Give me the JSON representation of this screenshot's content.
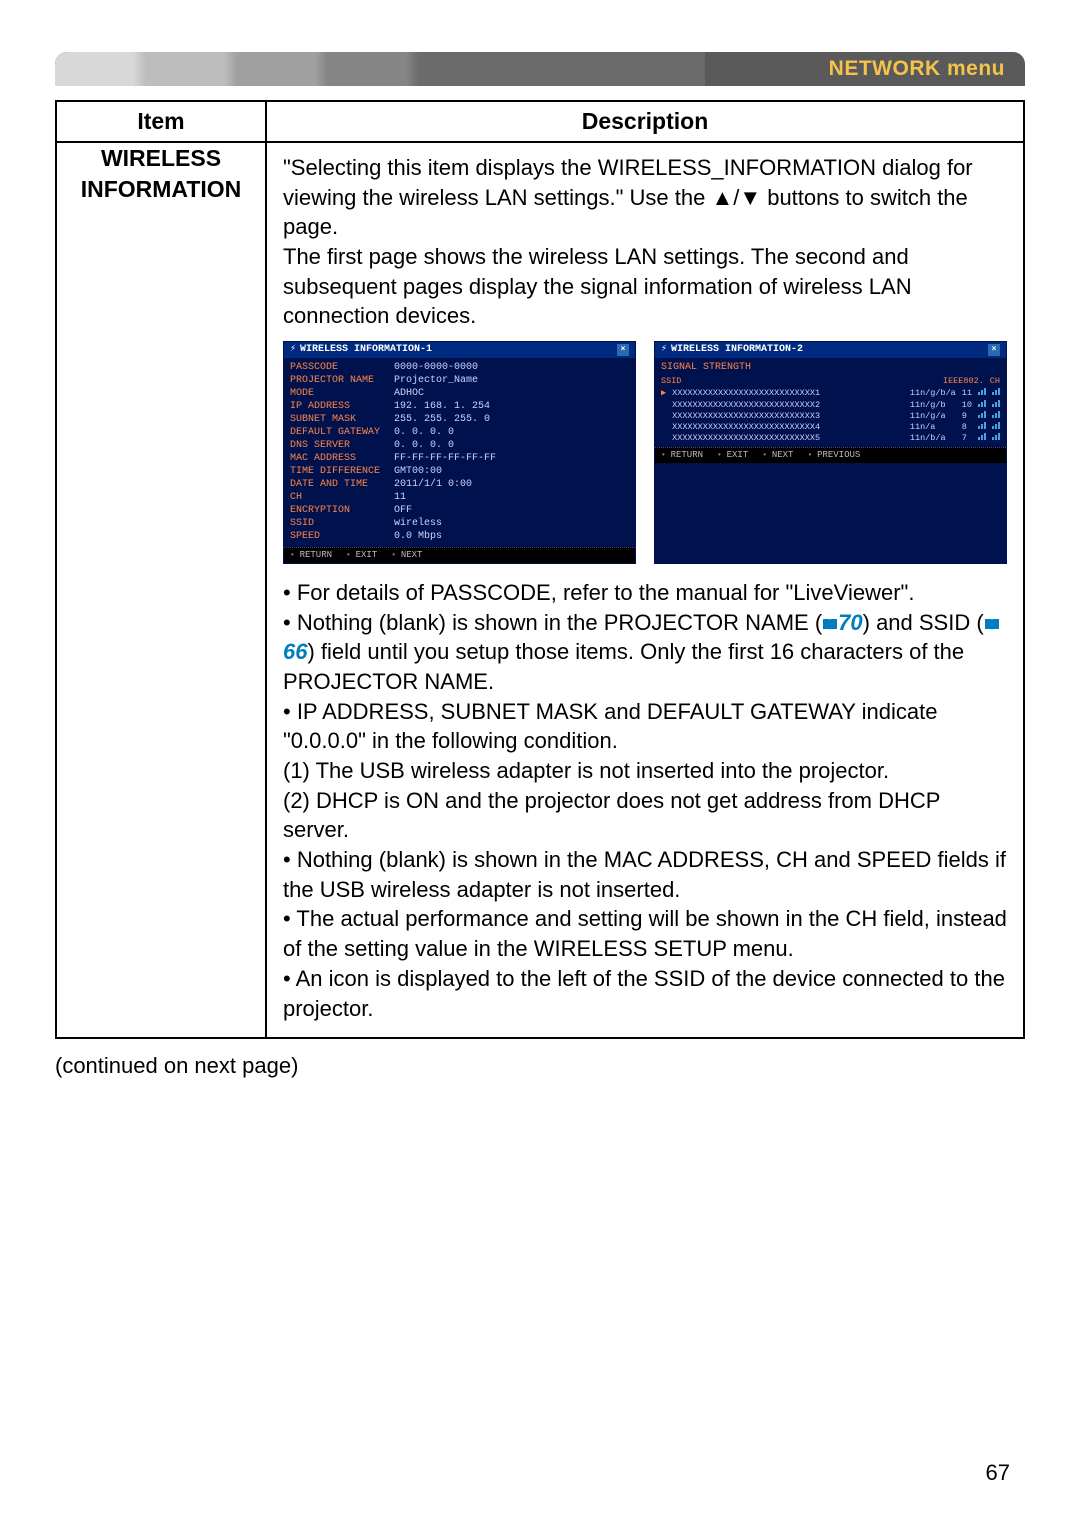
{
  "banner": {
    "title": "NETWORK menu"
  },
  "table": {
    "headers": {
      "item": "Item",
      "description": "Description"
    },
    "row": {
      "item_line1": "WIRELESS",
      "item_line2": "INFORMATION",
      "intro": "\"Selecting this item displays the WIRELESS_INFORMATION dialog for viewing the wireless LAN settings.\" Use the ▲/▼ buttons to switch the page.\nThe first page shows the wireless LAN settings. The second and subsequent pages display the signal information of wireless LAN connection devices.",
      "dialog1": {
        "title": "WIRELESS INFORMATION-1",
        "rows": [
          [
            "PASSCODE",
            "0000-0000-0000"
          ],
          [
            "PROJECTOR NAME",
            "Projector_Name"
          ],
          [
            "MODE",
            "ADHOC"
          ],
          [
            "IP ADDRESS",
            "192. 168. 1. 254"
          ],
          [
            "SUBNET MASK",
            "255. 255. 255. 0"
          ],
          [
            "DEFAULT GATEWAY",
            "0. 0. 0. 0"
          ],
          [
            "DNS SERVER",
            "0. 0. 0. 0"
          ],
          [
            "MAC ADDRESS",
            "FF-FF-FF-FF-FF-FF"
          ],
          [
            "TIME DIFFERENCE",
            "GMT00:00"
          ],
          [
            "DATE AND TIME",
            "2011/1/1  0:00"
          ],
          [
            "CH",
            "11"
          ],
          [
            "ENCRYPTION",
            "OFF"
          ],
          [
            "SSID",
            "wireless"
          ],
          [
            "SPEED",
            "0.0 Mbps"
          ]
        ],
        "footer": [
          "RETURN",
          "EXIT",
          "NEXT"
        ]
      },
      "dialog2": {
        "title": "WIRELESS INFORMATION-2",
        "heading": "SIGNAL STRENGTH",
        "header_cols": [
          "SSID",
          "IEEE802.",
          "CH"
        ],
        "rows": [
          [
            "▶",
            "XXXXXXXXXXXXXXXXXXXXXXXXXXXX1",
            "11n/g/b/a",
            "11"
          ],
          [
            "",
            "XXXXXXXXXXXXXXXXXXXXXXXXXXXX2",
            "11n/g/b",
            "10"
          ],
          [
            "",
            "XXXXXXXXXXXXXXXXXXXXXXXXXXXX3",
            "11n/g/a",
            "9"
          ],
          [
            "",
            "XXXXXXXXXXXXXXXXXXXXXXXXXXXX4",
            "11n/a",
            "8"
          ],
          [
            "",
            "XXXXXXXXXXXXXXXXXXXXXXXXXXXX5",
            "11n/b/a",
            "7"
          ]
        ],
        "footer": [
          "RETURN",
          "EXIT",
          "NEXT",
          "PREVIOUS"
        ]
      },
      "bullets_pre_ref1": "• For details of PASSCODE, refer to the manual for \"LiveViewer\".\n• Nothing (blank) is shown in the PROJECTOR NAME (",
      "ref1": "70",
      "bullets_mid_ref": ") and SSID (",
      "ref2": "66",
      "bullets_post_refs": ") field until you setup those items. Only the first 16 characters of the PROJECTOR NAME.\n• IP ADDRESS, SUBNET MASK and DEFAULT GATEWAY indicate \"0.0.0.0\" in the following condition.\n(1) The USB wireless adapter is not inserted into the projector.\n(2) DHCP is ON and the projector does not get address from DHCP server.\n• Nothing (blank) is shown in the MAC ADDRESS, CH and SPEED fields if the USB wireless adapter is not inserted.\n• The actual performance and setting will be shown in the CH field, instead of the setting value in the WIRELESS SETUP menu.\n• An icon is displayed to the left of the SSID of the device connected to the projector."
    }
  },
  "continued_text": "(continued on next page)",
  "page_number": "67"
}
